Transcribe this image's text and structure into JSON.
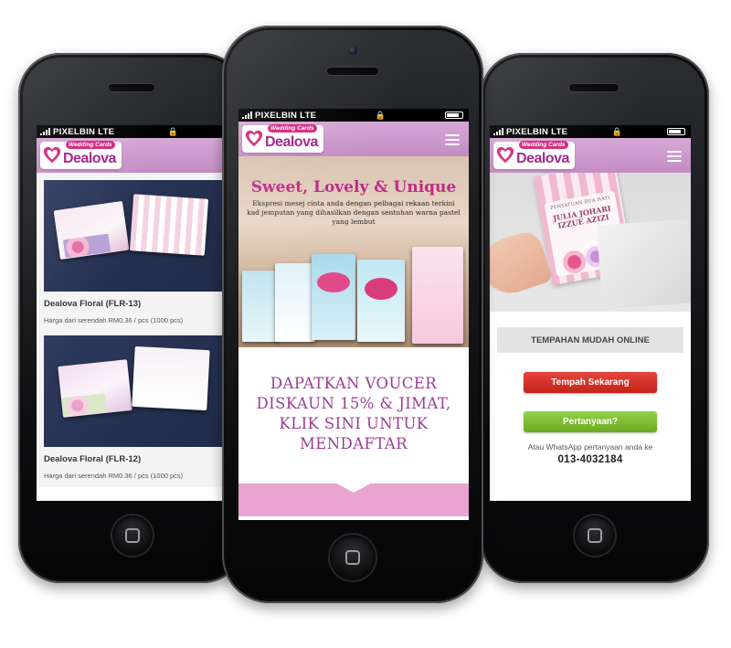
{
  "status_bar": {
    "carrier": "PIXELBIN",
    "network": "LTE"
  },
  "brand": {
    "name": "Dealova",
    "tagline": "Wedding Cards"
  },
  "left_phone": {
    "products": [
      {
        "name": "Dealova Floral (FLR-13)",
        "price": "Harga dari serendah RM0.36 / pcs (1000 pcs)"
      },
      {
        "name": "Dealova Floral (FLR-12)",
        "price": "Harga dari serendah RM0.36 / pcs (1000 pcs)"
      }
    ]
  },
  "center_phone": {
    "hero_title": "Sweet, Lovely & Unique",
    "hero_subtitle": "Ekspresi mesej cinta anda dengan pelbagai rekaan terkini kad jemputan yang dihasilkan dengan sentuhan warna pastel yang lembut",
    "promo_text": "DAPATKAN VOUCER DISKAUN 15% & JIMAT, KLIK SINI UNTUK MENDAFTAR"
  },
  "right_phone": {
    "invite_heading": "PENYATUAN DUA HATI",
    "invite_names": "JULIA JOHARI IZZUE AZIZI",
    "booking_title": "TEMPAHAN MUDAH ONLINE",
    "order_button": "Tempah Sekarang",
    "question_button": "Pertanyaan?",
    "whatsapp_text": "Atau WhatsApp pertanyaan anda ke",
    "whatsapp_number": "013-4032184"
  },
  "colors": {
    "brand_purple": "#c38cc4",
    "brand_magenta": "#c02a86",
    "promo_text": "#9c3d96",
    "order_red": "#d8332a",
    "question_green": "#7fbf32"
  }
}
